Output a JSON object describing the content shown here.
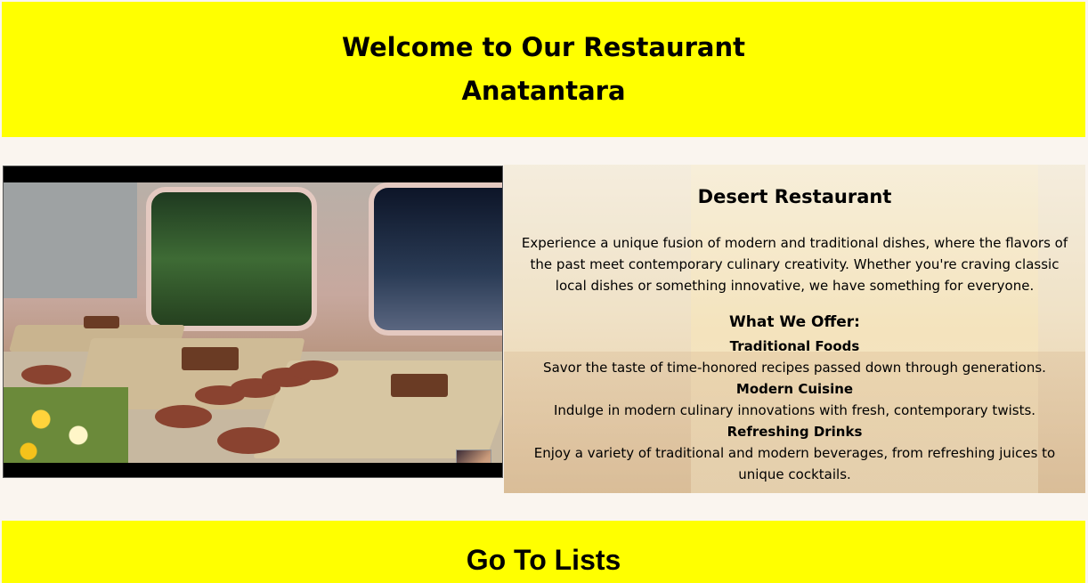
{
  "header": {
    "title_line1": "Welcome to Our Restaurant",
    "title_line2": "Anatantara"
  },
  "info": {
    "title": "Desert Restaurant",
    "description": "Experience a unique fusion of modern and traditional dishes, where the flavors of the past meet contemporary culinary creativity. Whether you're craving classic local dishes or something innovative, we have something for everyone.",
    "offer_heading": "What We Offer:",
    "offers": [
      {
        "title": "Traditional Foods",
        "text": "Savor the taste of time-honored recipes passed down through generations."
      },
      {
        "title": "Modern Cuisine",
        "text": "Indulge in modern culinary innovations with fresh, contemporary twists."
      },
      {
        "title": "Refreshing Drinks",
        "text": "Enjoy a variety of traditional and modern beverages, from refreshing juices to unique cocktails."
      }
    ]
  },
  "footer": {
    "link_label": "Go To Lists"
  }
}
